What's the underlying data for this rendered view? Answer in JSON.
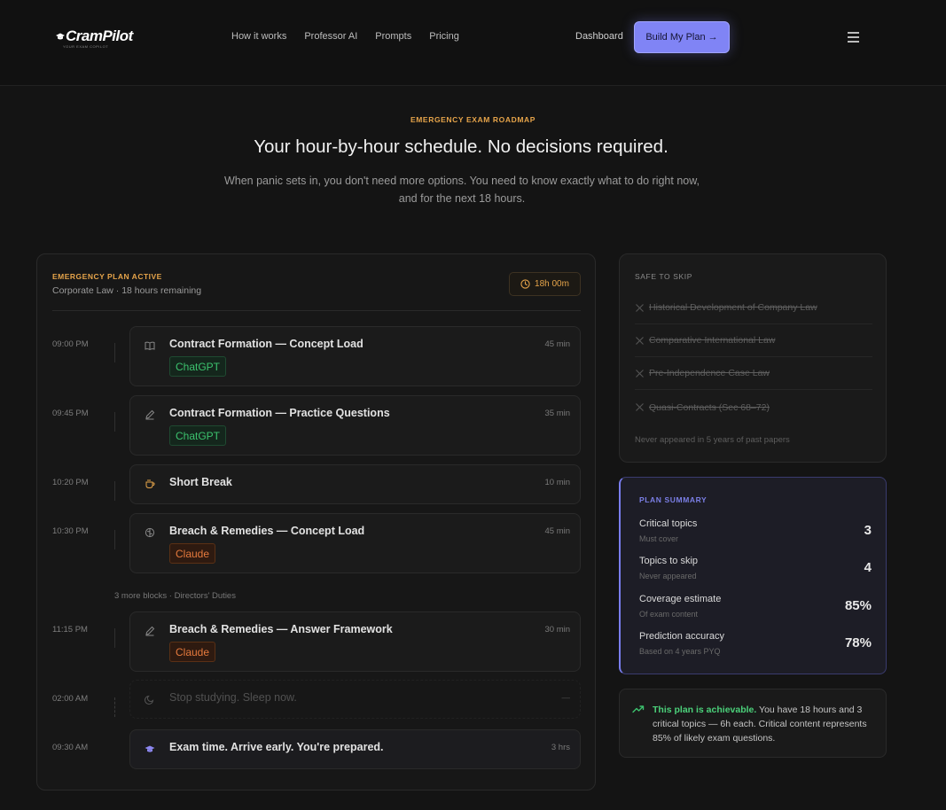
{
  "nav": {
    "logo_text": "CramPilot",
    "logo_tagline": "YOUR EXAM COPILOT",
    "links": [
      "How it works",
      "Professor AI",
      "Prompts",
      "Pricing"
    ],
    "dashboard": "Dashboard",
    "cta": "Build My Plan →"
  },
  "hero": {
    "eyebrow": "EMERGENCY EXAM ROADMAP",
    "title": "Your hour-by-hour schedule. No decisions required.",
    "subtitle": "When panic sets in, you don't need more options. You need to know exactly what to do right now, and for the next 18 hours."
  },
  "plan": {
    "status": "EMERGENCY PLAN ACTIVE",
    "meta": "Corporate Law · 18 hours remaining",
    "timer": "18h 00m",
    "more_blocks": "3 more blocks · Directors' Duties",
    "blocks": [
      {
        "time": "09:00 PM",
        "title": "Contract Formation — Concept Load",
        "duration": "45 min",
        "tag": "ChatGPT",
        "icon": "book-icon"
      },
      {
        "time": "09:45 PM",
        "title": "Contract Formation — Practice Questions",
        "duration": "35 min",
        "tag": "ChatGPT",
        "icon": "pencil-icon"
      },
      {
        "time": "10:20 PM",
        "title": "Short Break",
        "duration": "10 min",
        "tag": "",
        "icon": "coffee-icon"
      },
      {
        "time": "10:30 PM",
        "title": "Breach & Remedies — Concept Load",
        "duration": "45 min",
        "tag": "Claude",
        "icon": "brain-icon"
      },
      {
        "time": "11:15 PM",
        "title": "Breach & Remedies — Answer Framework",
        "duration": "30 min",
        "tag": "Claude",
        "icon": "pencil-icon"
      },
      {
        "time": "02:00 AM",
        "title": "Stop studying. Sleep now.",
        "duration": "—",
        "tag": "",
        "icon": "moon-icon"
      },
      {
        "time": "09:30 AM",
        "title": "Exam time. Arrive early. You're prepared.",
        "duration": "3 hrs",
        "tag": "",
        "icon": "graduation-cap-icon"
      }
    ]
  },
  "skip": {
    "title": "SAFE TO SKIP",
    "items": [
      "Historical Development of Company Law",
      "Comparative International Law",
      "Pre-Independence Case Law",
      "Quasi-Contracts (Sec 68–72)"
    ],
    "footer": "Never appeared in 5 years of past papers"
  },
  "summary": {
    "title": "PLAN SUMMARY",
    "rows": [
      {
        "label": "Critical topics",
        "sub": "Must cover",
        "value": "3"
      },
      {
        "label": "Topics to skip",
        "sub": "Never appeared",
        "value": "4"
      },
      {
        "label": "Coverage estimate",
        "sub": "Of exam content",
        "value": "85%"
      },
      {
        "label": "Prediction accuracy",
        "sub": "Based on 4 years PYQ",
        "value": "78%"
      }
    ]
  },
  "achievable": {
    "lead": "This plan is achievable.",
    "text": " You have 18 hours and 3 critical topics — 6h each. Critical content represents 85% of likely exam questions."
  },
  "colors": {
    "accent": "#8084f5",
    "warning": "#e6a44a",
    "success": "#3cc26e",
    "claude": "#e57a3d"
  }
}
